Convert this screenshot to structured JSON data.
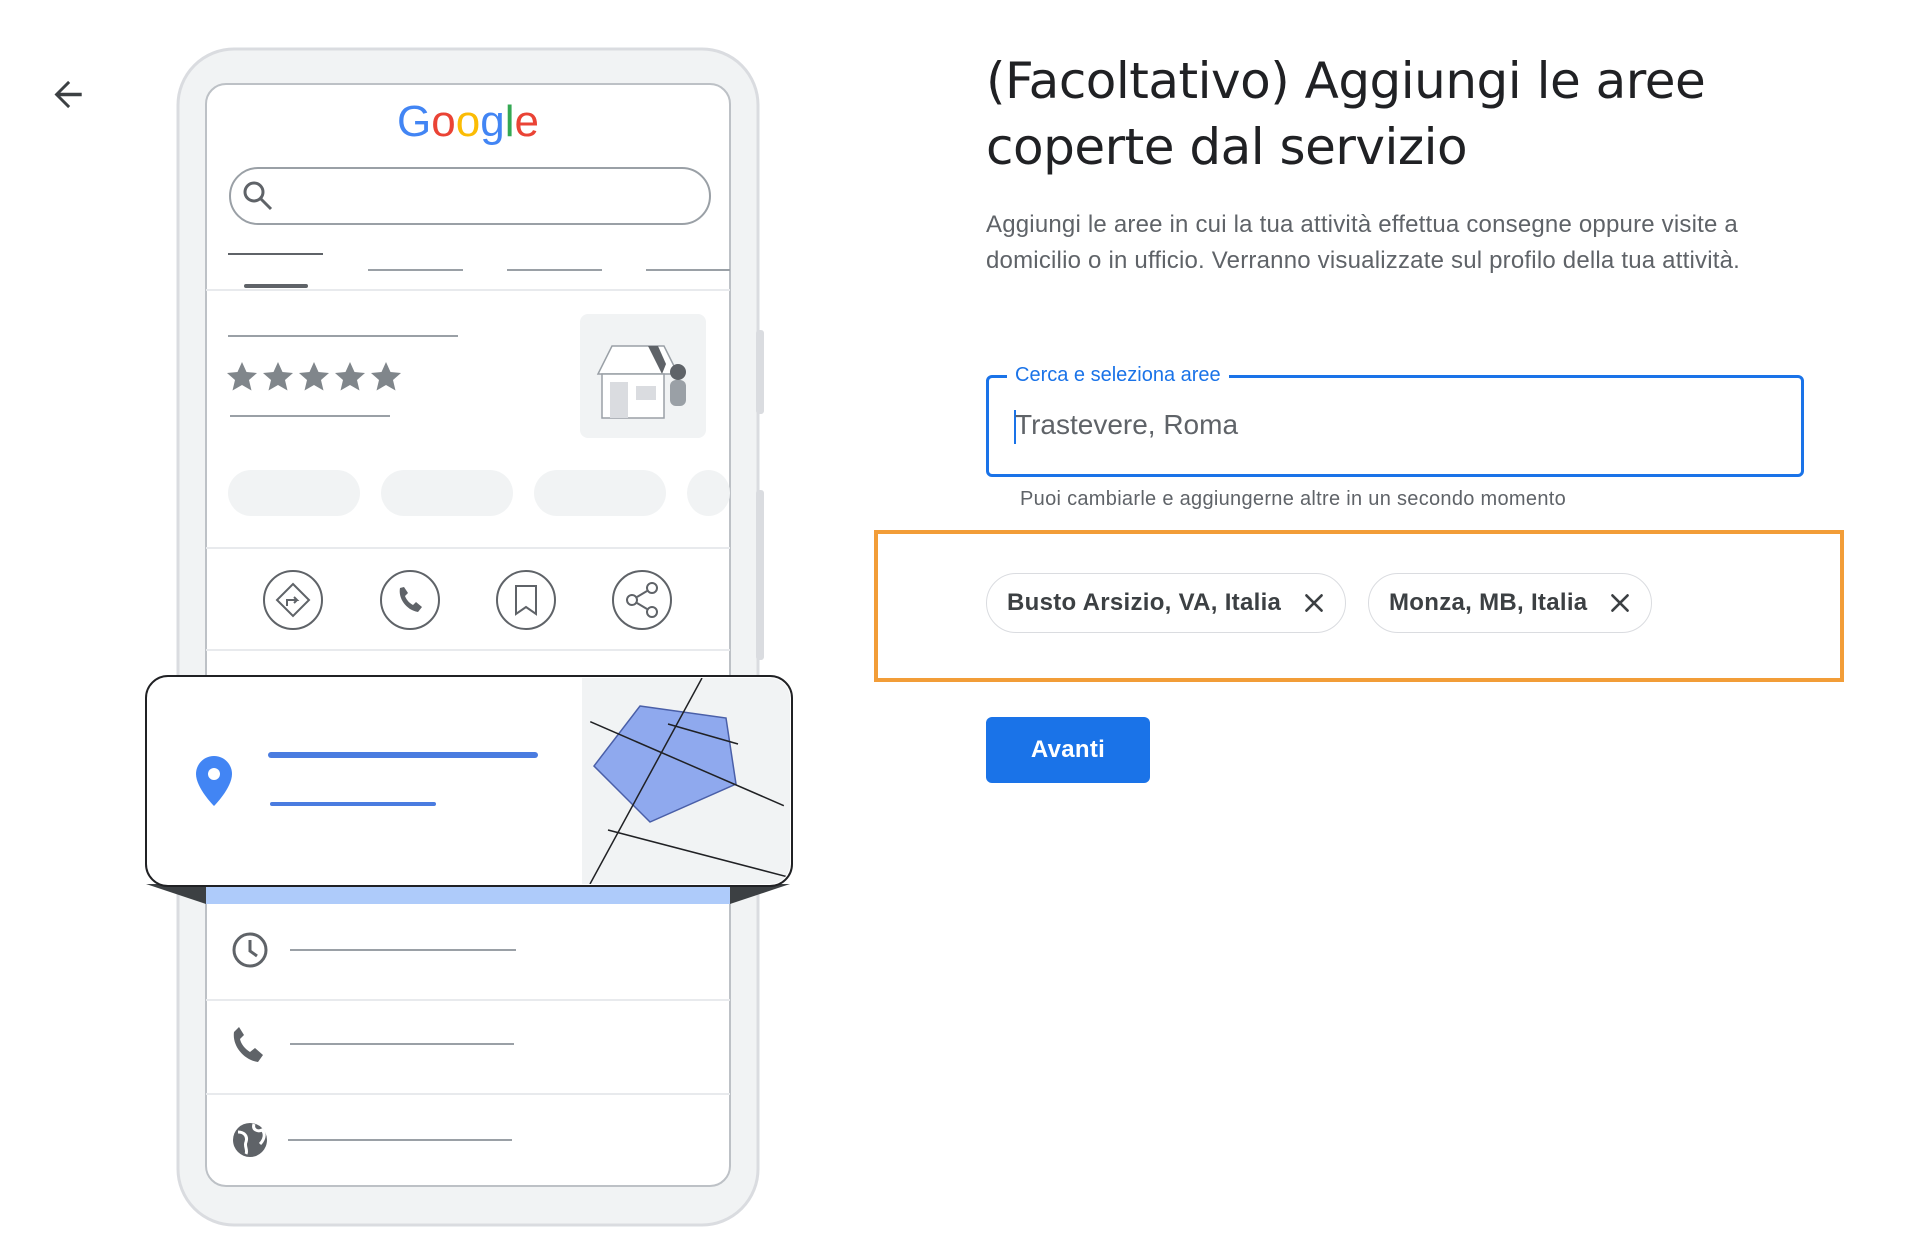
{
  "header": {
    "title": "(Facoltativo) Aggiungi le aree coperte dal servizio",
    "description": "Aggiungi le aree in cui la tua attività effettua consegne oppure visite a domicilio o in ufficio. Verranno visualizzate sul profilo della tua attività."
  },
  "search": {
    "label": "Cerca e seleziona aree",
    "placeholder": "Trastevere, Roma",
    "value": "",
    "helper": "Puoi cambiarle e aggiungerne altre in un secondo momento"
  },
  "chips": [
    {
      "label": "Busto Arsizio, VA, Italia",
      "remove_icon": "close-icon"
    },
    {
      "label": "Monza, MB, Italia",
      "remove_icon": "close-icon"
    }
  ],
  "actions": {
    "next_label": "Avanti",
    "back_icon": "arrow-back-icon"
  },
  "illustration": {
    "logo_text": "Google",
    "logo_colors": [
      "#4285F4",
      "#EA4335",
      "#FBBC05",
      "#4285F4",
      "#34A853",
      "#EA4335"
    ],
    "rating_stars": 5
  },
  "colors": {
    "accent": "#1a73e8",
    "highlight_border": "#f29d38",
    "map_area": "#8fa9ee"
  }
}
